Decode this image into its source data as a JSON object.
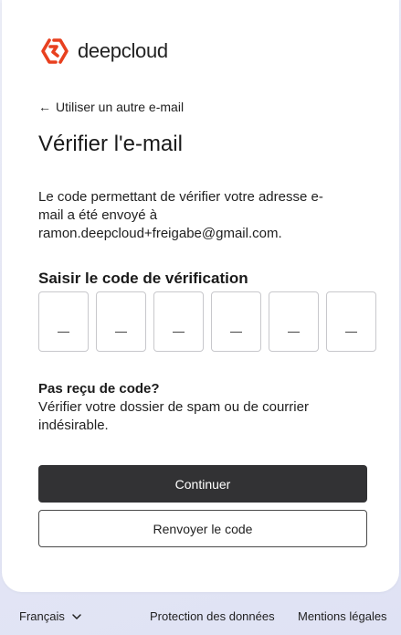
{
  "brand": {
    "name": "deepcloud",
    "color": "#e8401f"
  },
  "back_link": {
    "label": "Utiliser un autre e-mail",
    "icon": "arrow-left-icon"
  },
  "title": "Vérifier l'e-mail",
  "description": {
    "line1": "Le code permettant de vérifier votre adresse e-",
    "line2": "mail a été envoyé à",
    "email": "ramon.deepcloud+freigabe@gmail.com."
  },
  "code": {
    "label": "Saisir le code de vérification",
    "digits": [
      "",
      "",
      "",
      "",
      "",
      ""
    ]
  },
  "help": {
    "title": "Pas reçu de code?",
    "text": "Vérifier votre dossier de spam ou de courrier indésirable."
  },
  "buttons": {
    "continue": "Continuer",
    "resend": "Renvoyer le code"
  },
  "footer": {
    "language": "Français",
    "privacy": "Protection des données",
    "legal": "Mentions légales"
  }
}
